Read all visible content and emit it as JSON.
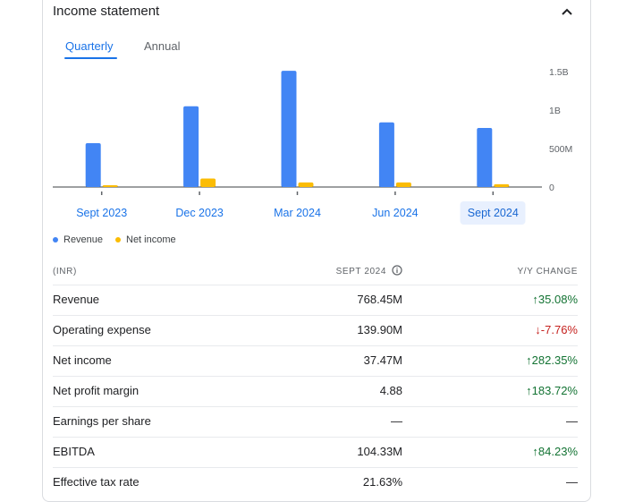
{
  "header": {
    "title": "Income statement",
    "collapse_icon": "chevron-up-icon"
  },
  "tabs": [
    {
      "label": "Quarterly",
      "selected": true
    },
    {
      "label": "Annual",
      "selected": false
    }
  ],
  "chart_data": {
    "type": "bar",
    "categories": [
      "Sept 2023",
      "Dec 2023",
      "Mar 2024",
      "Jun 2024",
      "Sept 2024"
    ],
    "selected_category": "Sept 2024",
    "series": [
      {
        "name": "Revenue",
        "color": "#4285f4",
        "values": [
          0.57,
          1.05,
          1.51,
          0.84,
          0.768
        ]
      },
      {
        "name": "Net income",
        "color": "#fbbc04",
        "values": [
          0.01,
          0.11,
          0.06,
          0.06,
          0.037
        ]
      }
    ],
    "unit": "B",
    "ylim": [
      0,
      1.5
    ],
    "yticks": [
      {
        "value": 0,
        "label": "0"
      },
      {
        "value": 0.5,
        "label": "500M"
      },
      {
        "value": 1,
        "label": "1B"
      },
      {
        "value": 1.5,
        "label": "1.5B"
      }
    ],
    "legend_position": "bottom-left"
  },
  "table": {
    "header": {
      "col1": "(INR)",
      "col2": "SEPT 2024",
      "col3": "Y/Y CHANGE",
      "info_icon": "info-icon"
    },
    "rows": [
      {
        "label": "Revenue",
        "value": "768.45M",
        "change": "35.08%",
        "direction": "up"
      },
      {
        "label": "Operating expense",
        "value": "139.90M",
        "change": "-7.76%",
        "direction": "down"
      },
      {
        "label": "Net income",
        "value": "37.47M",
        "change": "282.35%",
        "direction": "up"
      },
      {
        "label": "Net profit margin",
        "value": "4.88",
        "change": "183.72%",
        "direction": "up"
      },
      {
        "label": "Earnings per share",
        "value": "—",
        "change": "—",
        "direction": "none"
      },
      {
        "label": "EBITDA",
        "value": "104.33M",
        "change": "84.23%",
        "direction": "up"
      },
      {
        "label": "Effective tax rate",
        "value": "21.63%",
        "change": "—",
        "direction": "none"
      }
    ]
  }
}
